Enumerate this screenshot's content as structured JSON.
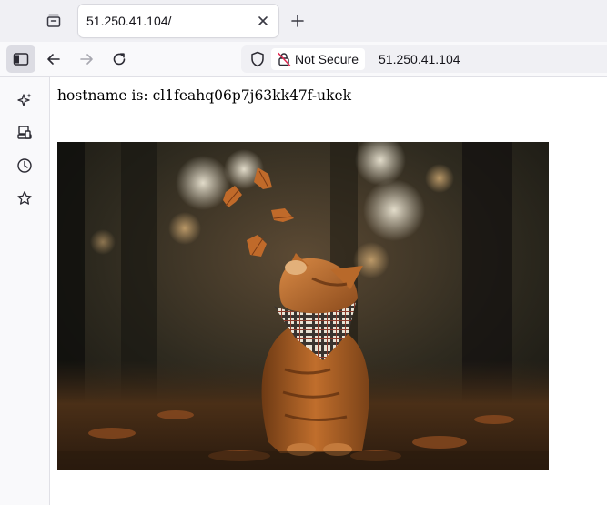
{
  "tab": {
    "title": "51.250.41.104/"
  },
  "navbar": {
    "security_label": "Not Secure",
    "url": "51.250.41.104"
  },
  "page": {
    "hostname_line": "hostname is: cl1feahq06p7j63kk47f-ukek"
  },
  "image": {
    "description": "autumn orange tabby cat in plaid bandana looking up at falling leaves"
  },
  "icons": {
    "tab_list": "tab-list-icon",
    "close": "close-icon",
    "new_tab": "plus-icon",
    "sidebar": "sidebar-icon",
    "back": "back-arrow-icon",
    "forward": "forward-arrow-icon",
    "reload": "reload-icon",
    "shield": "shield-icon",
    "insecure": "insecure-lock-icon",
    "ai": "ai-sparkle-icon",
    "synced_tabs": "synced-tabs-icon",
    "history": "history-clock-icon",
    "bookmarks": "bookmark-star-icon"
  }
}
